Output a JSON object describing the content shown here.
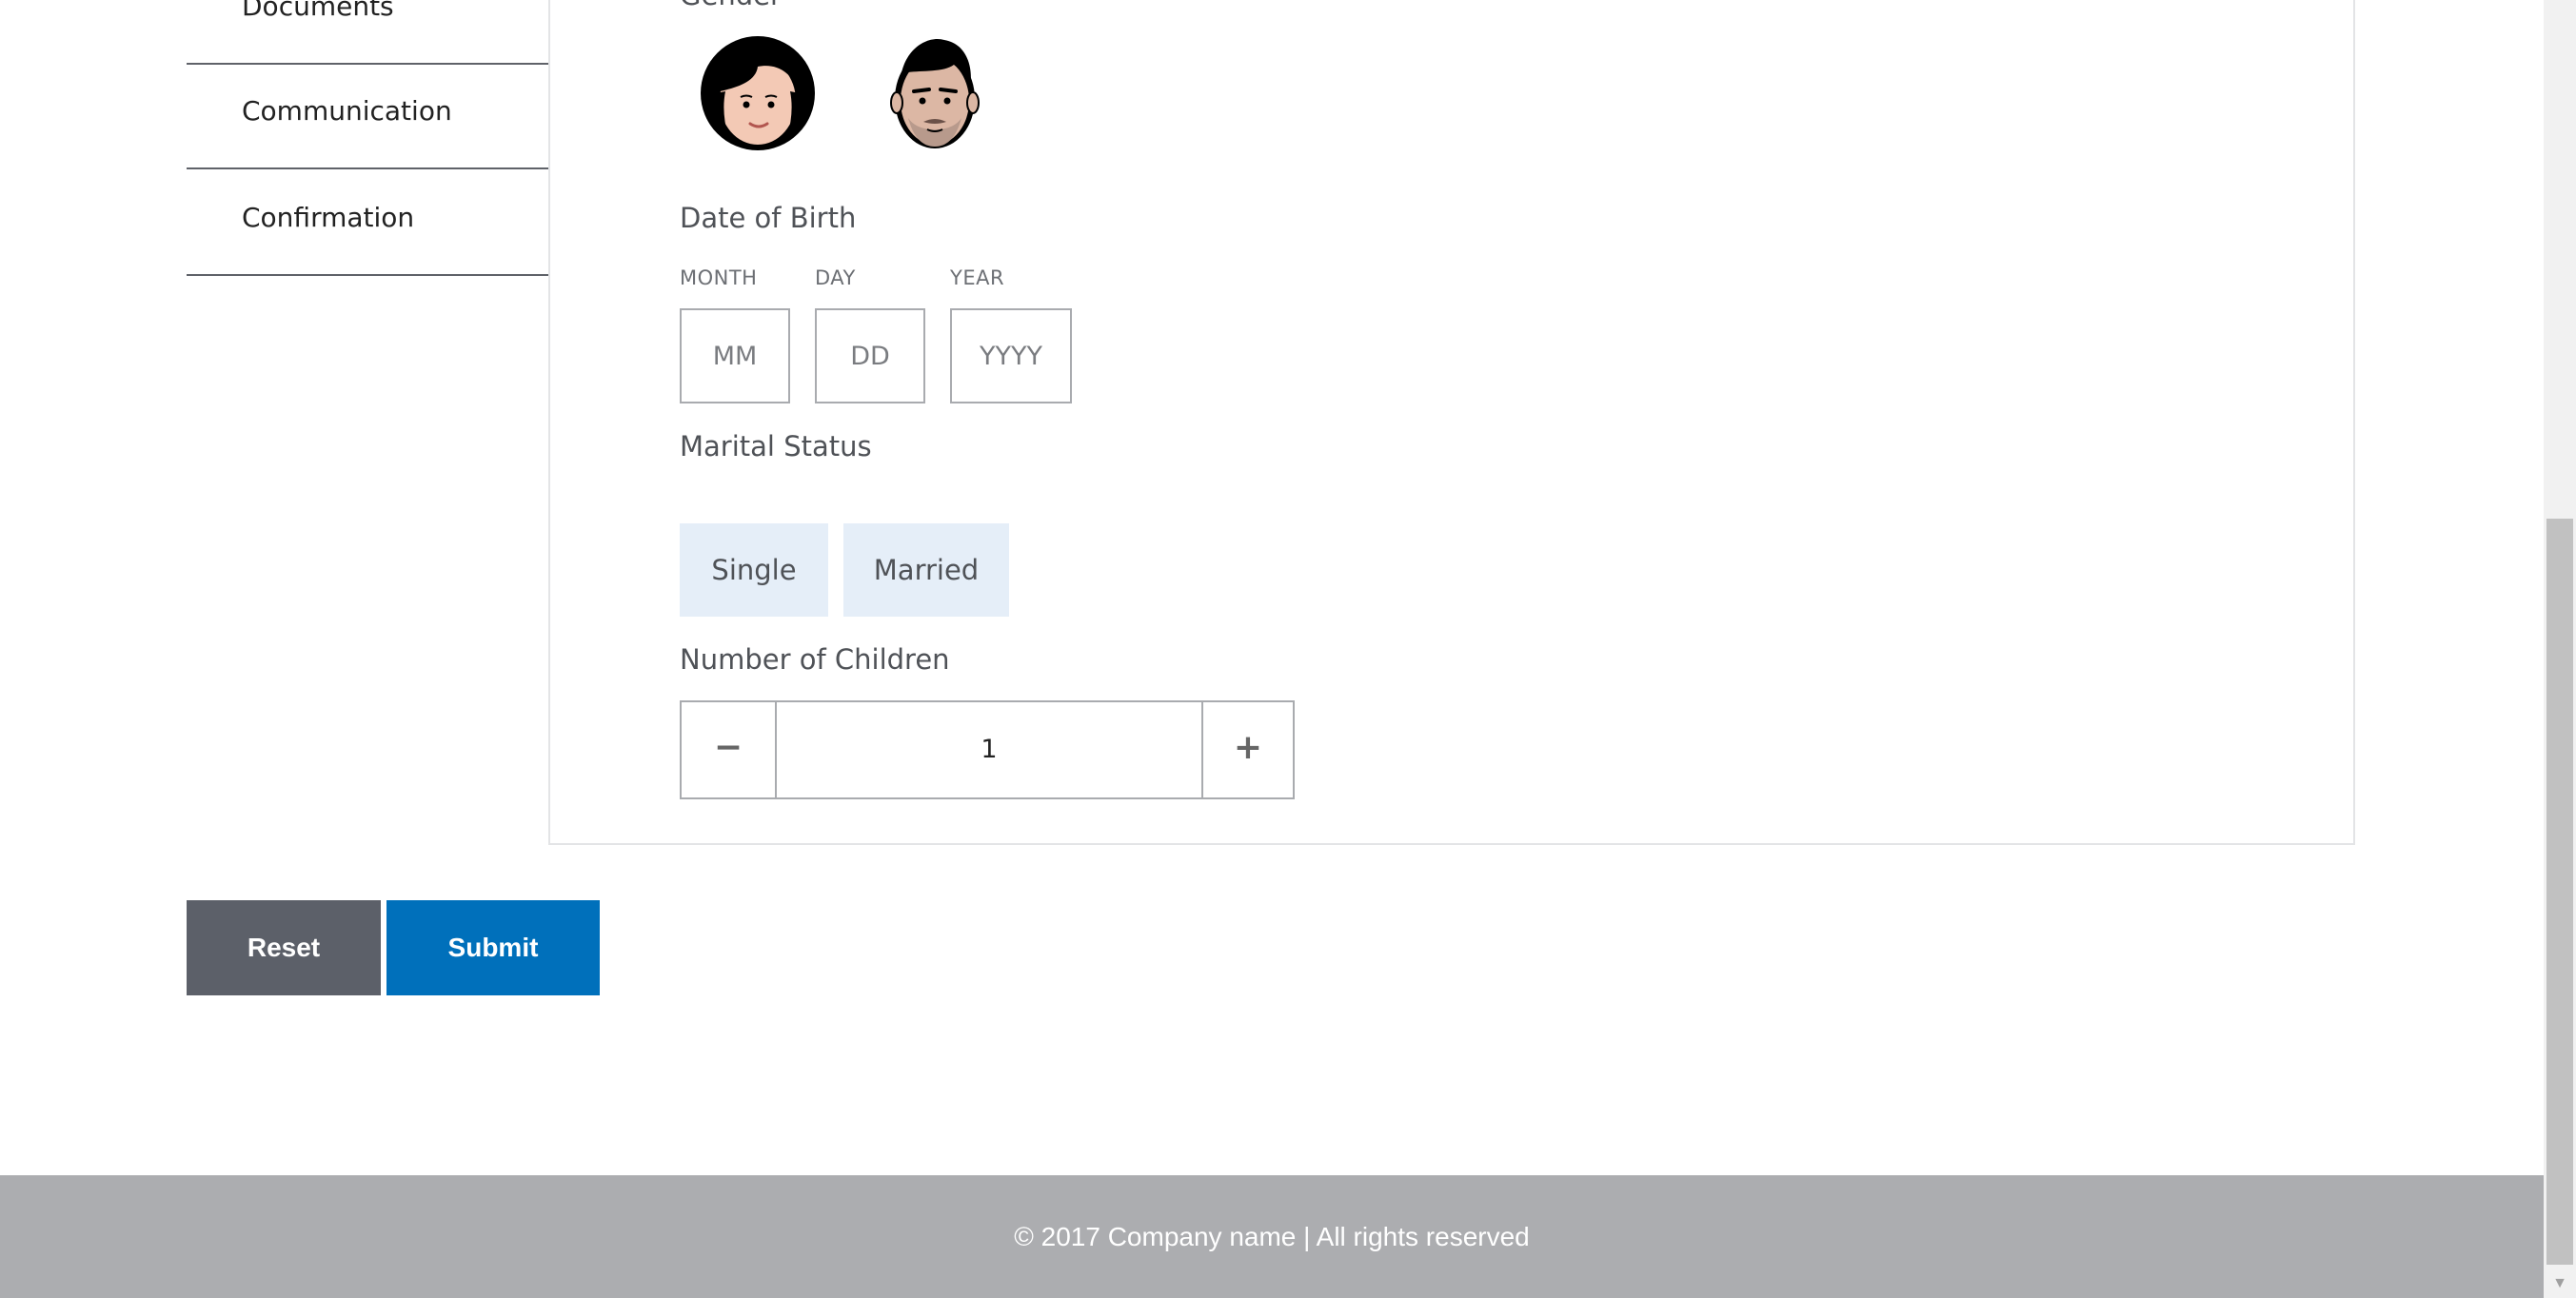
{
  "sidebar": {
    "items": [
      {
        "label": "Documents"
      },
      {
        "label": "Communication"
      },
      {
        "label": "Confirmation"
      }
    ]
  },
  "form": {
    "gender": {
      "label": "Gender",
      "options": [
        {
          "name": "female",
          "icon": "female-avatar-icon"
        },
        {
          "name": "male",
          "icon": "male-avatar-icon"
        }
      ]
    },
    "dob": {
      "label": "Date of Birth",
      "month_label": "MONTH",
      "month_placeholder": "MM",
      "day_label": "DAY",
      "day_placeholder": "DD",
      "year_label": "YEAR",
      "year_placeholder": "YYYY"
    },
    "marital": {
      "label": "Marital Status",
      "options": [
        "Single",
        "Married"
      ]
    },
    "children": {
      "label": "Number of Children",
      "minus": "−",
      "plus": "+",
      "value": "1"
    }
  },
  "actions": {
    "reset_label": "Reset",
    "submit_label": "Submit"
  },
  "footer": {
    "text": "© 2017 Company name | All rights reserved"
  },
  "colors": {
    "submit": "#0070bb",
    "reset": "#5c6069",
    "chip_bg": "#e5eef8",
    "footer_bg": "#acadb0"
  }
}
